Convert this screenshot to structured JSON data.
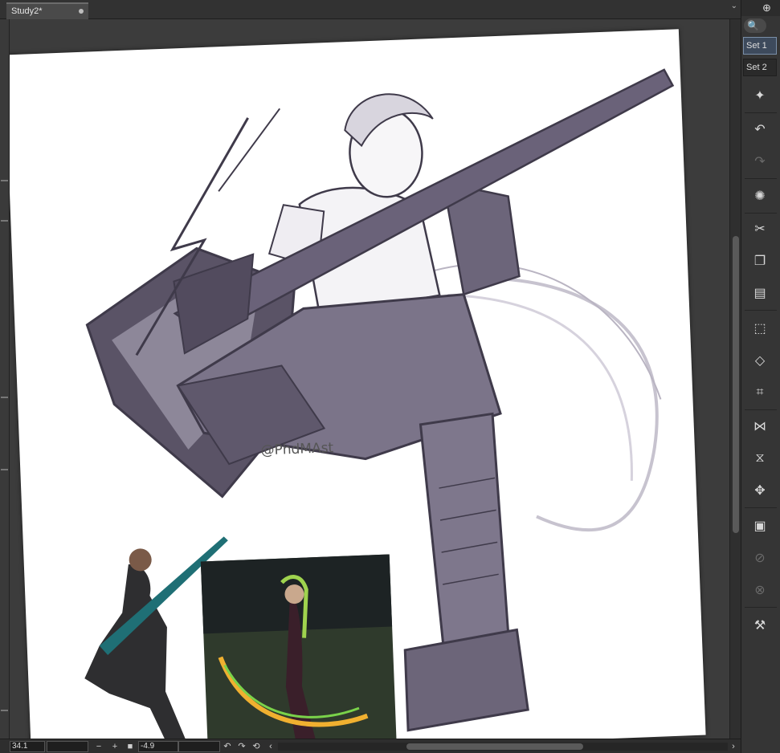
{
  "document": {
    "tab_title": "Study2*",
    "watermark": "@PhdMAst"
  },
  "right_palette": {
    "search_icon": "zoom-icon",
    "sets": [
      {
        "label": "Set 1",
        "active": true
      },
      {
        "label": "Set 2",
        "active": false
      }
    ],
    "tools": [
      {
        "name": "new-icon",
        "glyph": "🆕"
      },
      {
        "name": "undo-icon",
        "glyph": "↶"
      },
      {
        "name": "redo-icon",
        "glyph": "↷"
      },
      {
        "name": "loading-icon",
        "glyph": "✺"
      },
      {
        "name": "cut-icon",
        "glyph": "✂"
      },
      {
        "name": "copy-icon",
        "glyph": "⧉"
      },
      {
        "name": "paste-icon",
        "glyph": "📋"
      },
      {
        "name": "transform-icon",
        "glyph": "⬚"
      },
      {
        "name": "free-transform-icon",
        "glyph": "◇"
      },
      {
        "name": "mesh-transform-icon",
        "glyph": "⌗"
      },
      {
        "name": "flip-horizontal-icon",
        "glyph": "⊳⊲"
      },
      {
        "name": "flip-vertical-icon",
        "glyph": "⩡"
      },
      {
        "name": "move-icon",
        "glyph": "✥"
      },
      {
        "name": "layer-settings-icon",
        "glyph": "▣"
      },
      {
        "name": "link-icon",
        "glyph": "⊘"
      },
      {
        "name": "unlink-icon",
        "glyph": "⊗"
      },
      {
        "name": "settings-wrench-icon",
        "glyph": "🔧"
      }
    ]
  },
  "status": {
    "zoom": "34.1",
    "rotation": "-4.9"
  },
  "colors": {
    "panel": "#353535",
    "canvas_bg": "#3c3c3c",
    "active_set": "#3d4a5c",
    "ink": "#3f3a4a",
    "shade": "#8d8799"
  }
}
